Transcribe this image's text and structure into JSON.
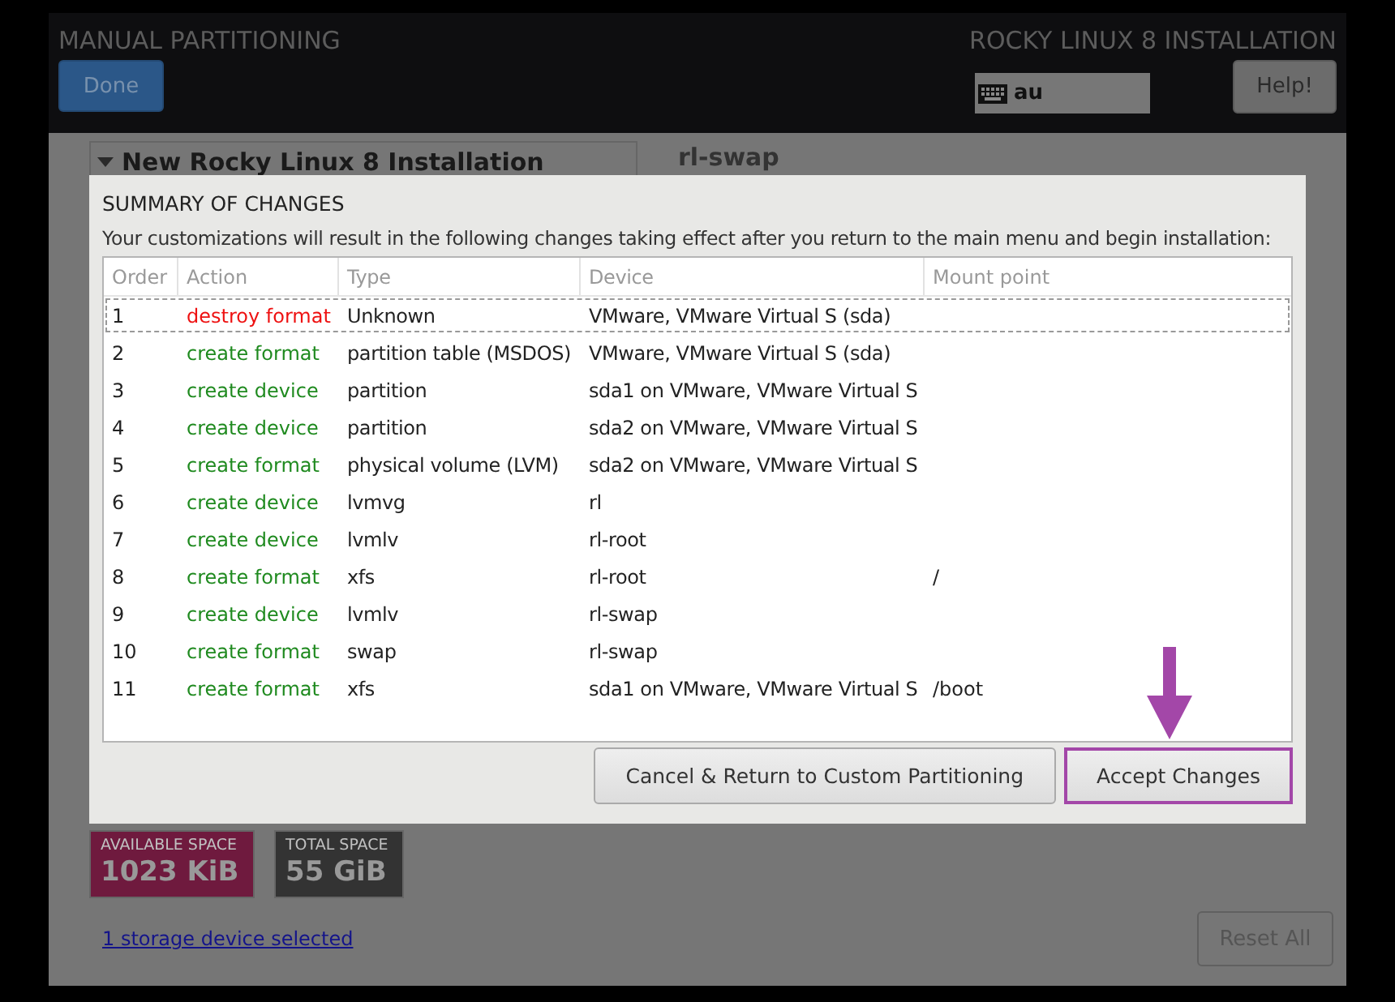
{
  "header": {
    "title": "MANUAL PARTITIONING",
    "done_button": "Done",
    "product": "ROCKY LINUX 8 INSTALLATION",
    "keyboard": "au",
    "help_button": "Help!"
  },
  "background": {
    "section_title": "New Rocky Linux 8 Installation",
    "device_name": "rl-swap",
    "available_space": {
      "label": "AVAILABLE SPACE",
      "value": "1023 KiB"
    },
    "total_space": {
      "label": "TOTAL SPACE",
      "value": "55 GiB"
    },
    "storage_link": "1 storage device selected",
    "reset_button": "Reset All"
  },
  "dialog": {
    "title": "SUMMARY OF CHANGES",
    "description": "Your customizations will result in the following changes taking effect after you return to the main menu and begin installation:",
    "table": {
      "columns": [
        "Order",
        "Action",
        "Type",
        "Device",
        "Mount point"
      ],
      "rows": [
        {
          "order": "1",
          "action": "destroy format",
          "kind": "destroy",
          "type": "Unknown",
          "device": "VMware, VMware Virtual S (sda)",
          "selected": true
        },
        {
          "order": "2",
          "action": "create format",
          "kind": "create",
          "type": "partition table (MSDOS)",
          "device": "VMware, VMware Virtual S (sda)",
          "selected": false
        },
        {
          "order": "3",
          "action": "create device",
          "kind": "create",
          "type": "partition",
          "device": "sda1 on VMware, VMware Virtual S",
          "selected": false
        },
        {
          "order": "4",
          "action": "create device",
          "kind": "create",
          "type": "partition",
          "device": "sda2 on VMware, VMware Virtual S",
          "selected": false
        },
        {
          "order": "5",
          "action": "create format",
          "kind": "create",
          "type": "physical volume (LVM)",
          "device": "sda2 on VMware, VMware Virtual S",
          "selected": false
        },
        {
          "order": "6",
          "action": "create device",
          "kind": "create",
          "type": "lvmvg",
          "device": "rl",
          "selected": false
        },
        {
          "order": "7",
          "action": "create device",
          "kind": "create",
          "type": "lvmlv",
          "device": "rl-root",
          "selected": false
        },
        {
          "order": "8",
          "action": "create format",
          "kind": "create",
          "type": "xfs",
          "device": "rl-root",
          "mount_point": "/",
          "selected": false
        },
        {
          "order": "9",
          "action": "create device",
          "kind": "create",
          "type": "lvmlv",
          "device": "rl-swap",
          "selected": false
        },
        {
          "order": "10",
          "action": "create format",
          "kind": "create",
          "type": "swap",
          "device": "rl-swap",
          "selected": false
        },
        {
          "order": "11",
          "action": "create format",
          "kind": "create",
          "type": "xfs",
          "device": "sda1 on VMware, VMware Virtual S",
          "mount_point": "/boot",
          "selected": false
        }
      ]
    },
    "buttons": [
      {
        "label": "Cancel & Return to Custom Partitioning",
        "highlighted": false
      },
      {
        "label": "Accept Changes",
        "highlighted": true
      }
    ]
  }
}
